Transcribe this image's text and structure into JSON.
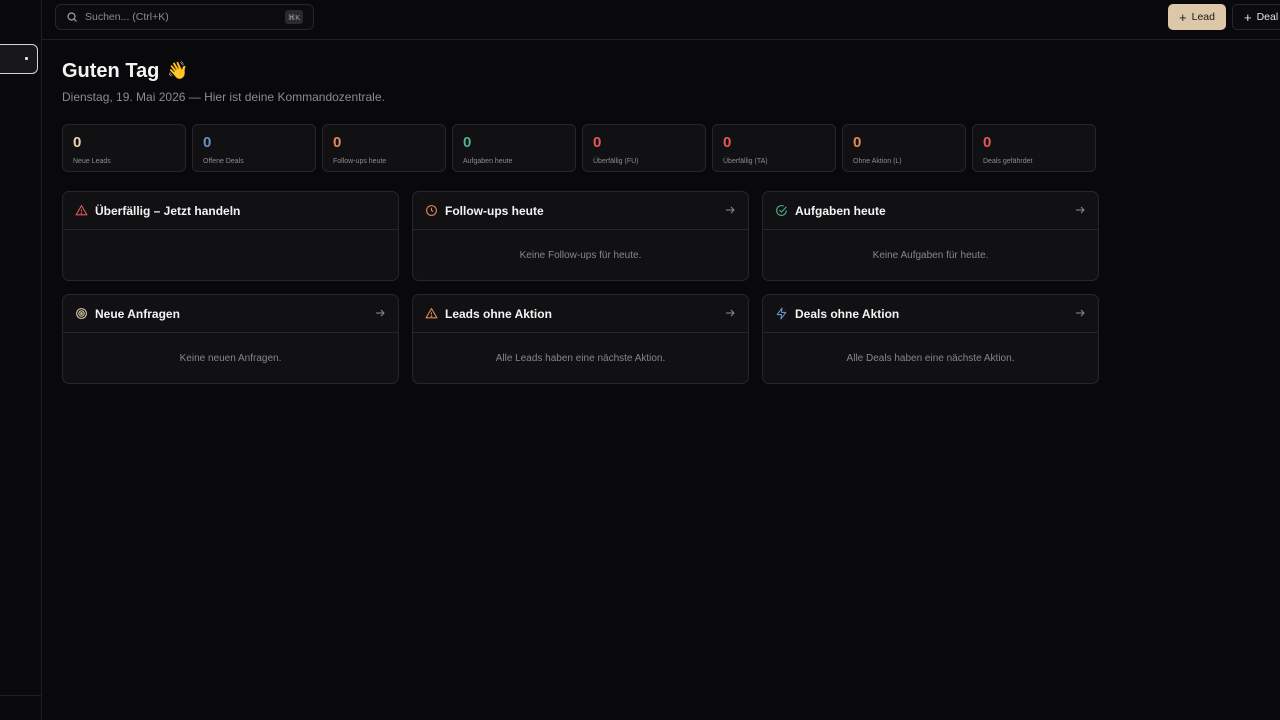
{
  "search": {
    "placeholder": "Suchen... (Ctrl+K)",
    "shortcut": "⌘K"
  },
  "actions": {
    "lead_label": "Lead",
    "deal_label": "Deal"
  },
  "header": {
    "greeting": "Guten Tag",
    "emoji": "👋",
    "subtitle": "Dienstag, 19. Mai 2026 — Hier ist deine Kommandozentrale."
  },
  "stats": [
    {
      "value": "0",
      "label": "Neue Leads",
      "color": "#e8d3b0"
    },
    {
      "value": "0",
      "label": "Offene Deals",
      "color": "#6b8fc4"
    },
    {
      "value": "0",
      "label": "Follow-ups heute",
      "color": "#e0895a"
    },
    {
      "value": "0",
      "label": "Aufgaben heute",
      "color": "#4fb08a"
    },
    {
      "value": "0",
      "label": "Überfällig (FU)",
      "color": "#e05a5a"
    },
    {
      "value": "0",
      "label": "Überfällig (TA)",
      "color": "#e05a5a"
    },
    {
      "value": "0",
      "label": "Ohne Aktion (L)",
      "color": "#e0895a"
    },
    {
      "value": "0",
      "label": "Deals gefährdet",
      "color": "#e05a5a"
    }
  ],
  "cards": [
    {
      "title": "Überfällig – Jetzt handeln",
      "icon": "alert-triangle-icon",
      "empty": ""
    },
    {
      "title": "Follow-ups heute",
      "icon": "clock-icon",
      "empty": "Keine Follow-ups für heute."
    },
    {
      "title": "Aufgaben heute",
      "icon": "check-circle-icon",
      "empty": "Keine Aufgaben für heute."
    },
    {
      "title": "Neue Anfragen",
      "icon": "target-icon",
      "empty": "Keine neuen Anfragen."
    },
    {
      "title": "Leads ohne Aktion",
      "icon": "alert-triangle-icon",
      "empty": "Alle Leads haben eine nächste Aktion."
    },
    {
      "title": "Deals ohne Aktion",
      "icon": "zap-icon",
      "empty": "Alle Deals haben eine nächste Aktion."
    }
  ],
  "colors": {
    "accent": "#dcc7a8",
    "danger": "#e05a5a",
    "warning": "#e0895a",
    "success": "#4fb08a",
    "info": "#6b8fc4"
  }
}
